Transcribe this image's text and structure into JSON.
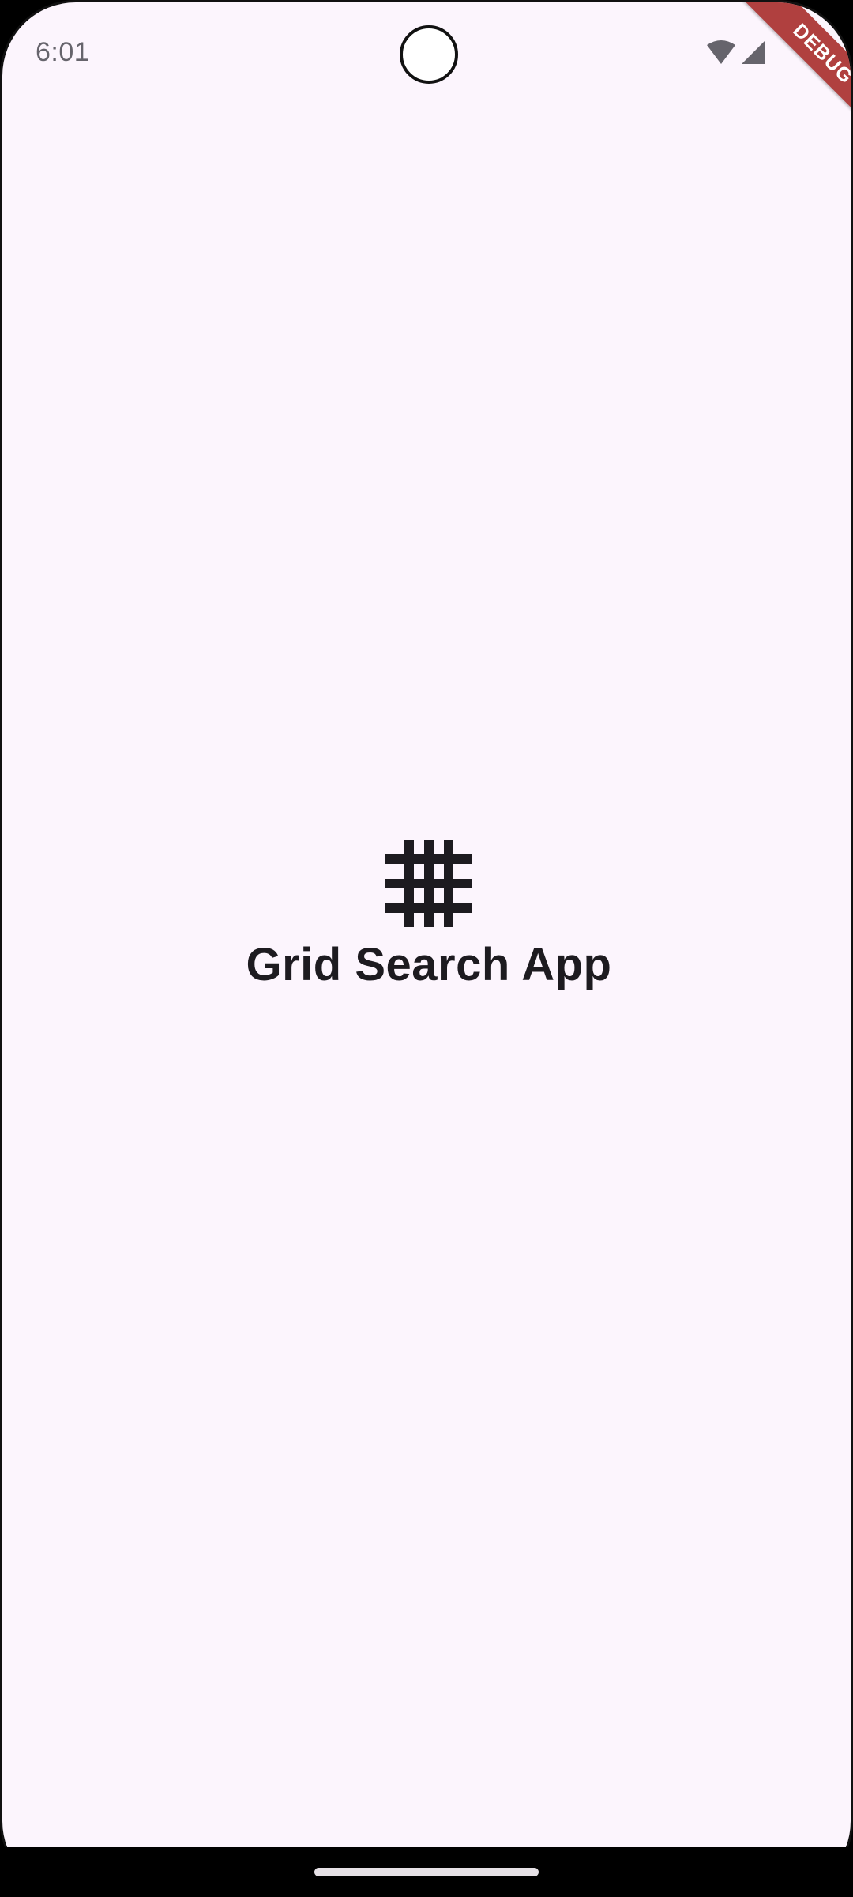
{
  "status_bar": {
    "time": "6:01",
    "icons": [
      "wifi-icon",
      "cellular-signal-icon"
    ]
  },
  "debug_banner": {
    "label": "DEBUG",
    "color": "#B0403F"
  },
  "main": {
    "icon": "grid-icon",
    "title": "Grid Search App"
  },
  "colors": {
    "background": "#FCF5FD",
    "text": "#1D1B20",
    "status_text": "#66646C"
  }
}
